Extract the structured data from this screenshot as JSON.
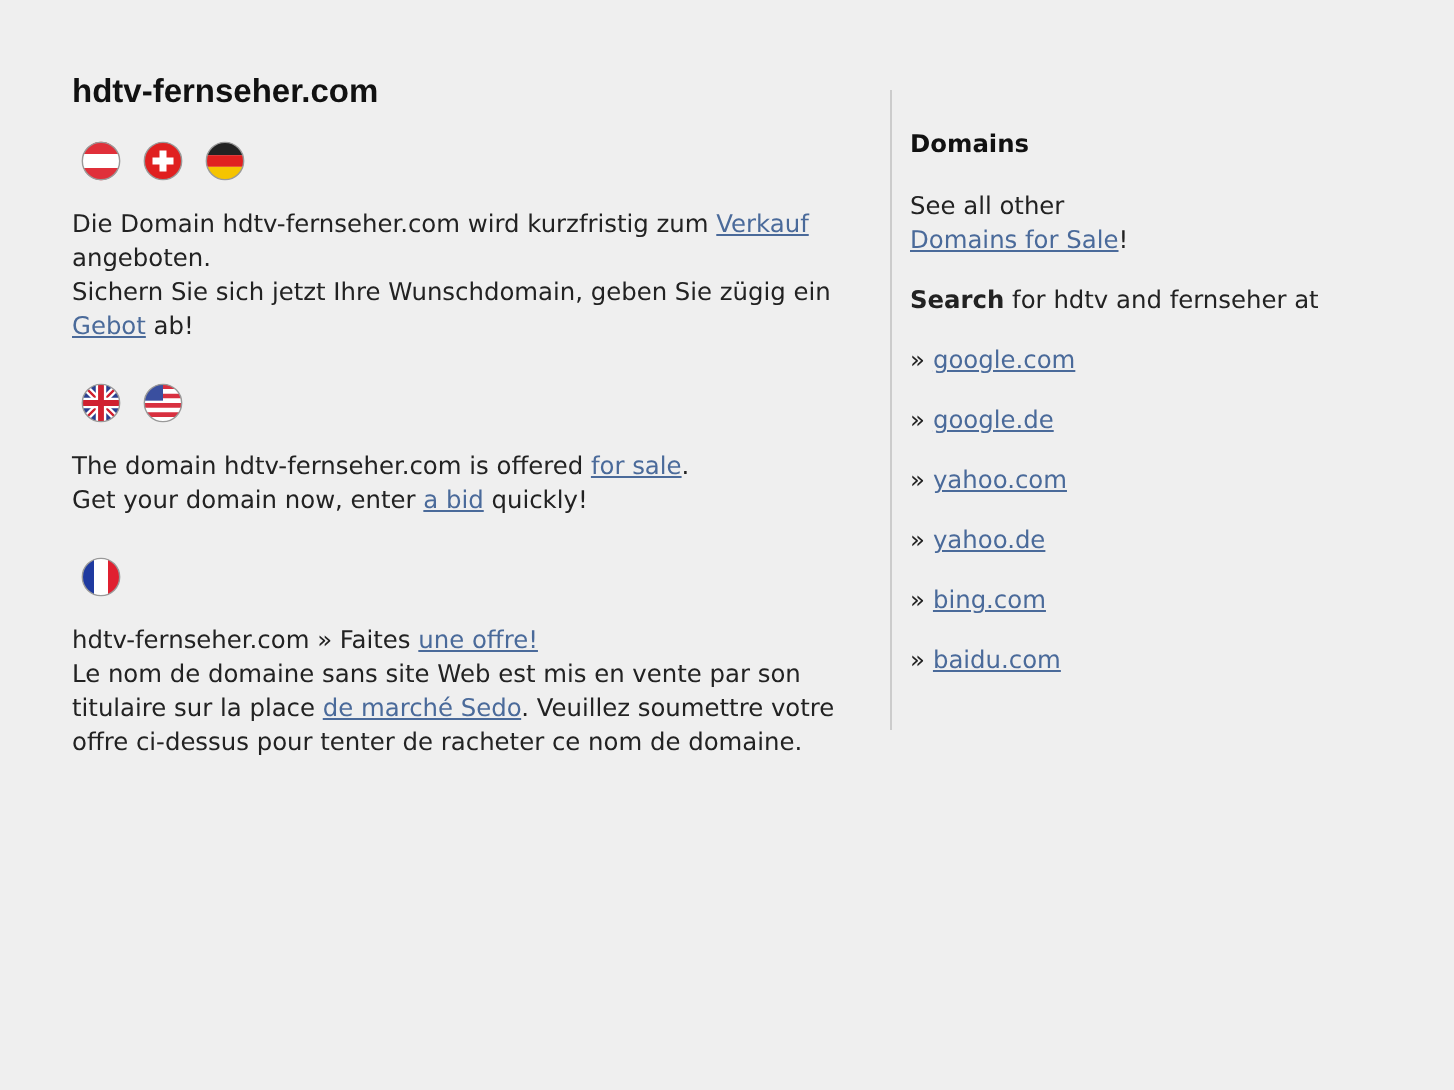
{
  "title": "hdtv-fernseher.com",
  "sections": [
    {
      "flags": [
        {
          "kind": "at"
        },
        {
          "kind": "ch"
        },
        {
          "kind": "de"
        }
      ],
      "lines": [
        [
          {
            "text": "Die Domain hdtv-fernseher.com wird kurzfristig zum "
          },
          {
            "link": "Verkauf"
          },
          {
            "text": " angeboten."
          }
        ],
        [
          {
            "text": "Sichern Sie sich jetzt Ihre Wunschdomain, geben Sie zügig ein "
          },
          {
            "link": "Gebot"
          },
          {
            "text": " ab!"
          }
        ]
      ]
    },
    {
      "flags": [
        {
          "kind": "gb"
        },
        {
          "kind": "us"
        }
      ],
      "lines": [
        [
          {
            "text": "The domain hdtv-fernseher.com is offered "
          },
          {
            "link": "for sale"
          },
          {
            "text": "."
          }
        ],
        [
          {
            "text": "Get your domain now, enter "
          },
          {
            "link": "a bid"
          },
          {
            "text": " quickly!"
          }
        ]
      ]
    },
    {
      "flags": [
        {
          "kind": "fr"
        }
      ],
      "lines": [
        [
          {
            "text": "hdtv-fernseher.com » Faites "
          },
          {
            "link": "une offre!"
          }
        ],
        [
          {
            "text": "Le nom de domaine sans site Web est mis en vente par son titulaire sur la place "
          },
          {
            "link": "de marché Sedo"
          },
          {
            "text": ". Veuillez soumettre votre offre ci-dessus pour tenter de racheter ce nom de domaine."
          }
        ]
      ]
    }
  ],
  "sidebar": {
    "heading": "Domains",
    "intro": [
      [
        {
          "text": "See all other"
        }
      ],
      [
        {
          "link": "Domains for Sale"
        },
        {
          "text": "!"
        }
      ]
    ],
    "search_text": "**Search** for hdtv and fernseher at",
    "links": [
      {
        "prefix": "»",
        "label": "google.com"
      },
      {
        "prefix": "»",
        "label": "google.de"
      },
      {
        "prefix": "»",
        "label": "yahoo.com"
      },
      {
        "prefix": "»",
        "label": "yahoo.de"
      },
      {
        "prefix": "»",
        "label": "bing.com"
      },
      {
        "prefix": "»",
        "label": "baidu.com"
      }
    ]
  }
}
